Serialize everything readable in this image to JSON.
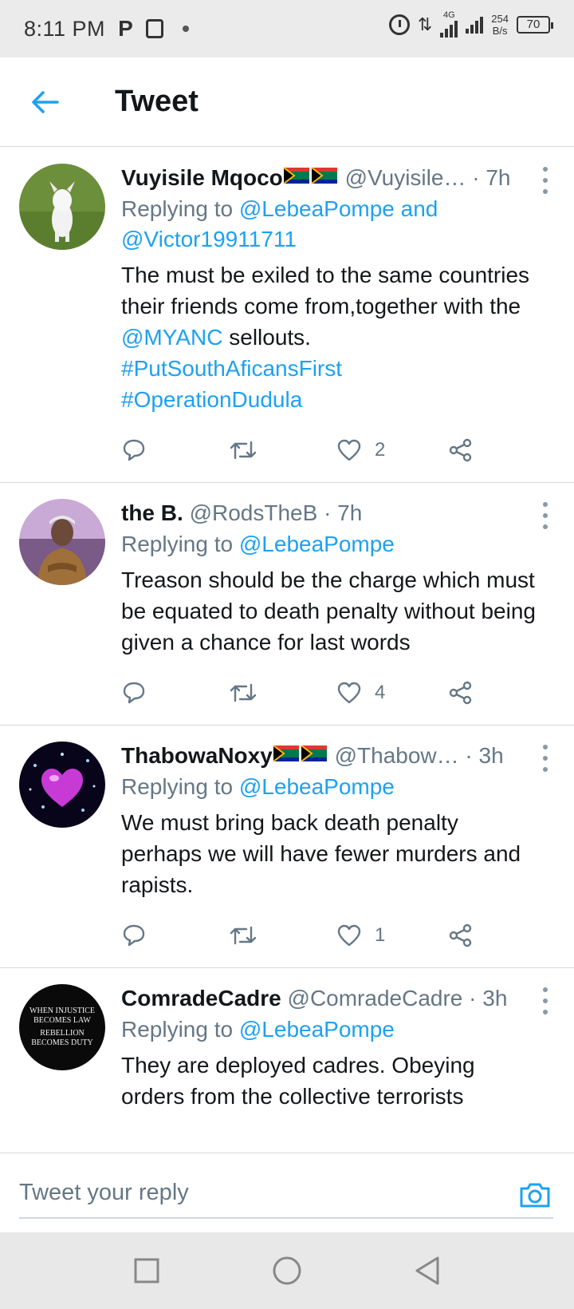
{
  "status": {
    "time": "8:11 PM",
    "network": "4G",
    "speed_value": "254",
    "speed_unit": "B/s",
    "battery": "70"
  },
  "header": {
    "title": "Tweet"
  },
  "tweets": [
    {
      "name": "Vuyisile Mqoco",
      "handle": "@Vuyisile…",
      "time": "· 7h",
      "replying_prefix": "Replying to ",
      "replying_to": "@LebeaPompe and @Victor19911711",
      "text_1": "The must be exiled to the same countries their friends come from,together with the ",
      "mention": "@MYANC",
      "text_2": " sellouts.",
      "hashtag_1": "#PutSouthAficansFirst",
      "hashtag_2": "#OperationDudula",
      "likes": "2"
    },
    {
      "name": "the B.",
      "handle": "@RodsTheB",
      "time": "· 7h",
      "replying_prefix": "Replying to ",
      "replying_to": "@LebeaPompe",
      "text": "Treason should be the charge which must be equated to death penalty without being given a chance for last words",
      "likes": "4"
    },
    {
      "name": "ThabowaNoxy",
      "handle": "@Thabow…",
      "time": "· 3h",
      "replying_prefix": "Replying to ",
      "replying_to": "@LebeaPompe",
      "text": "We must bring back death penalty perhaps we will have fewer murders and rapists.",
      "likes": "1"
    },
    {
      "name": "ComradeCadre",
      "handle": "@ComradeCadre",
      "time": "· 3h",
      "replying_prefix": "Replying to ",
      "replying_to": "@LebeaPompe",
      "text": "They are deployed cadres. Obeying orders from the collective terrorists",
      "avatar_text_1": "WHEN INJUSTICE",
      "avatar_text_2": "BECOMES LAW",
      "avatar_text_3": "REBELLION",
      "avatar_text_4": "BECOMES DUTY"
    }
  ],
  "reply_bar": {
    "placeholder": "Tweet your reply"
  },
  "colors": {
    "accent": "#1da1f2",
    "secondary": "#657786",
    "text": "#14171a"
  }
}
